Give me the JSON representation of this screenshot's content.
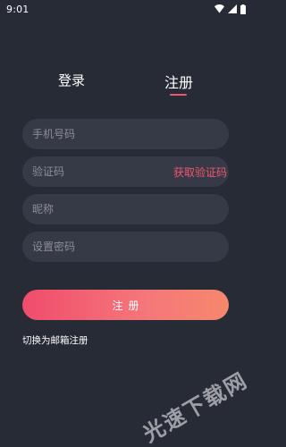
{
  "status_bar": {
    "time": "9:01",
    "icons": [
      "wifi-icon",
      "signal-icon",
      "battery-icon"
    ]
  },
  "tabs": [
    {
      "label": "登录",
      "selected": false
    },
    {
      "label": "注册",
      "selected": true
    }
  ],
  "form": {
    "phone_placeholder": "手机号码",
    "code_placeholder": "验证码",
    "get_code_label": "获取验证码",
    "nickname_placeholder": "昵称",
    "password_placeholder": "设置密码"
  },
  "submit_label": "注册",
  "switch_label": "切换为邮箱注册",
  "watermark": "光速下载网",
  "colors": {
    "background": "#272b36",
    "field": "#363a46",
    "accent": "#f0566f",
    "button_gradient_start": "#f04c6c",
    "button_gradient_end": "#f5886c"
  }
}
